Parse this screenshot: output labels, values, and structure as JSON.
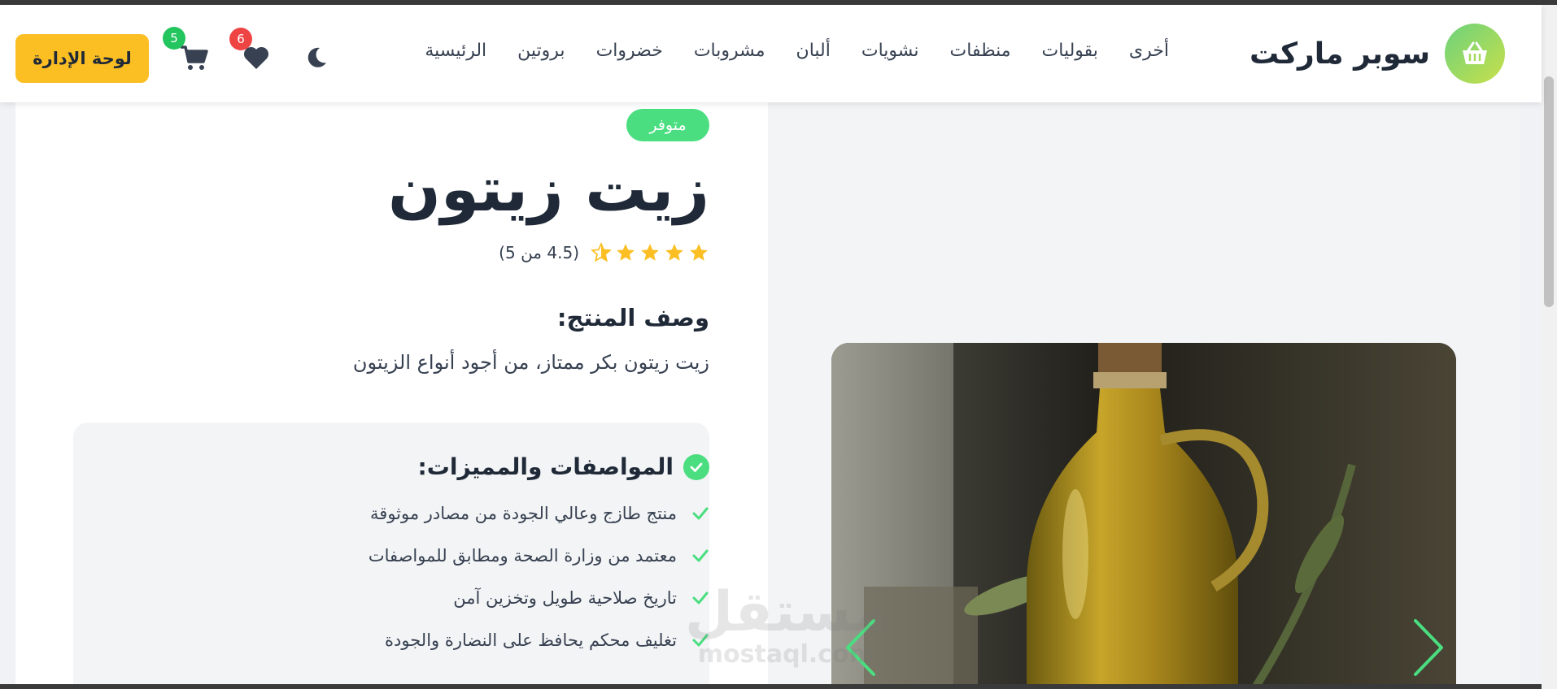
{
  "header": {
    "brand_name": "سوبر ماركت",
    "nav_items": [
      "الرئيسية",
      "بروتين",
      "خضروات",
      "مشروبات",
      "ألبان",
      "نشويات",
      "منظفات",
      "بقوليات",
      "أخرى"
    ],
    "wishlist_count": "6",
    "cart_count": "5",
    "admin_button": "لوحة الإدارة",
    "icons": [
      "basket-icon",
      "moon-icon",
      "heart-icon",
      "cart-icon"
    ]
  },
  "product": {
    "stock_status": "متوفر",
    "title": "زيت زيتون",
    "rating": 4.5,
    "rating_text": "(4.5 من 5)",
    "description_heading": "وصف المنتج:",
    "description": "زيت زيتون بكر ممتاز، من أجود أنواع الزيتون",
    "features_heading": "المواصفات والمميزات:",
    "features": [
      "منتج طازج وعالي الجودة من مصادر موثوقة",
      "معتمد من وزارة الصحة ومطابق للمواصفات",
      "تاريخ صلاحية طويل وتخزين آمن",
      "تغليف محكم يحافظ على النضارة والجودة"
    ]
  },
  "watermark": {
    "main": "مستقل",
    "sub": "mostaql.com"
  },
  "colors": {
    "accent_green": "#4ade80",
    "admin_yellow": "#fbbf24",
    "badge_red": "#ef4444",
    "star_yellow": "#fbbf24"
  }
}
